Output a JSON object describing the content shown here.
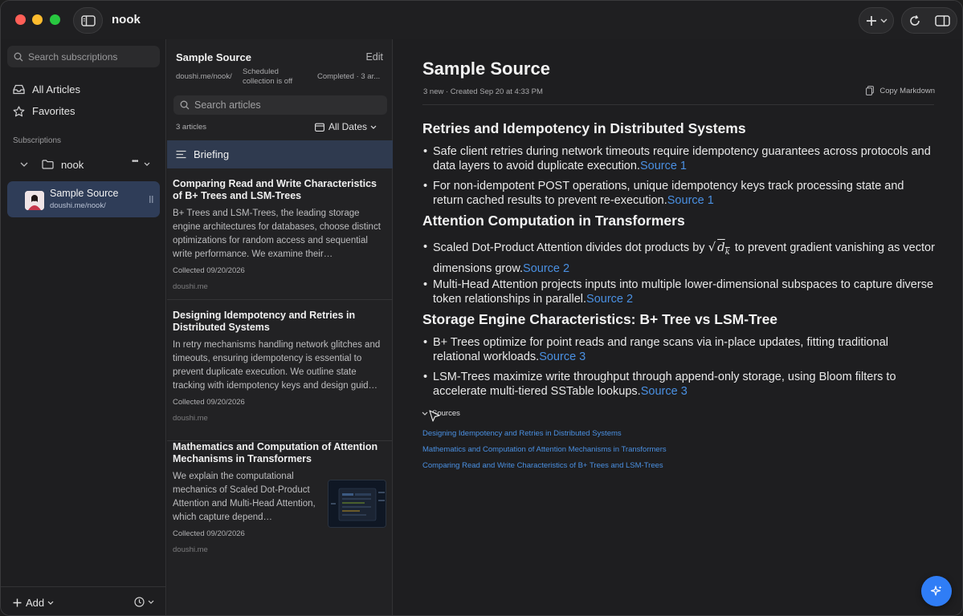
{
  "app": {
    "title": "nook"
  },
  "sidebar": {
    "search_placeholder": "Search subscriptions",
    "nav": [
      {
        "label": "All Articles",
        "icon": "inbox-icon"
      },
      {
        "label": "Favorites",
        "icon": "star-icon"
      }
    ],
    "section_label": "Subscriptions",
    "folder": {
      "label": "nook",
      "more": "•••"
    },
    "subscription": {
      "title": "Sample Source",
      "url": "doushi.me/nook/"
    },
    "add_label": "Add"
  },
  "list": {
    "title": "Sample Source",
    "edit_label": "Edit",
    "meta_url": "doushi.me/nook/",
    "meta_schedule": "Scheduled collection is off",
    "meta_status": "Completed · 3 ar...",
    "search_placeholder": "Search articles",
    "count": "3 articles",
    "date_filter": "All Dates",
    "briefing_label": "Briefing",
    "articles": [
      {
        "title": "Comparing Read and Write Characteristics of B+ Trees and LSM-Trees",
        "body": "B+ Trees and LSM-Trees, the leading storage engine architectures for databases, choose distinct optimizations for random access and sequential write performance. We examine their…",
        "collected": "Collected 09/20/2026",
        "domain": "doushi.me"
      },
      {
        "title": "Designing Idempotency and Retries in Distributed Systems",
        "body": "In retry mechanisms handling network glitches and timeouts, ensuring idempotency is essential to prevent duplicate execution. We outline state tracking with idempotency keys and design guid…",
        "collected": "Collected 09/20/2026",
        "domain": "doushi.me"
      },
      {
        "title": "Mathematics and Computation of Attention Mechanisms in Transformers",
        "body": "We explain the computational mechanics of Scaled Dot-Product Attention and Multi-Head Attention, which capture depend…",
        "collected": "Collected 09/20/2026",
        "domain": "doushi.me"
      }
    ]
  },
  "article": {
    "title": "Sample Source",
    "meta": "3 new · Created Sep 20 at 4:33 PM",
    "copy_label": "Copy Markdown",
    "sections": [
      {
        "heading": "Retries and Idempotency in Distributed Systems",
        "bullets": [
          {
            "text": "Safe client retries during network timeouts require idempotency guarantees across protocols and data layers to avoid duplicate execution.",
            "source": "Source 1"
          },
          {
            "text": "For non-idempotent POST operations, unique idempotency keys track processing state and return cached results to prevent re-execution.",
            "source": "Source 1"
          }
        ]
      },
      {
        "heading": "Attention Computation in Transformers",
        "bullets": [
          {
            "text_before": "Scaled Dot-Product Attention divides dot products by",
            "math": "d",
            "math_sub": "k",
            "text_after": "to prevent gradient vanishing as vector dimensions grow.",
            "source": "Source 2"
          },
          {
            "text": "Multi-Head Attention projects inputs into multiple lower-dimensional subspaces to capture diverse token relationships in parallel.",
            "source": "Source 2"
          }
        ]
      },
      {
        "heading": "Storage Engine Characteristics: B+ Tree vs LSM-Tree",
        "bullets": [
          {
            "text": "B+ Trees optimize for point reads and range scans via in-place updates, fitting traditional relational workloads.",
            "source": "Source 3"
          },
          {
            "text": "LSM-Trees maximize write throughput through append-only storage, using Bloom filters to accelerate multi-tiered SSTable lookups.",
            "source": "Source 3"
          }
        ]
      }
    ],
    "sources_label": "Sources",
    "sources": [
      "Designing Idempotency and Retries in Distributed Systems",
      "Mathematics and Computation of Attention Mechanisms in Transformers",
      "Comparing Read and Write Characteristics of B+ Trees and LSM-Trees"
    ]
  },
  "colors": {
    "accent": "#4a90e2",
    "fab": "#2f7df6",
    "selected": "#2f3d58"
  }
}
